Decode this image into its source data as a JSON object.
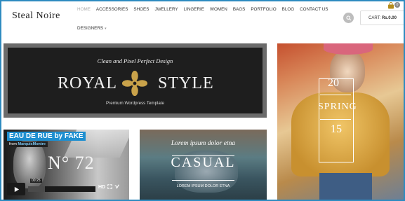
{
  "brand": {
    "logo": "Steal Noire"
  },
  "nav": {
    "items": [
      "Home",
      "Accessories",
      "Shoes",
      "Jwellery",
      "Lingerie",
      "Women",
      "Bags",
      "Portfolio",
      "Blog",
      "Contact Us"
    ],
    "row2": [
      "Designers"
    ],
    "active_index": 0
  },
  "cart": {
    "label": "CART:",
    "amount": "Rs.0.00",
    "count": "0"
  },
  "banner_royal": {
    "tagline": "Clean and Pixel Perfect Design",
    "word1": "ROYAL",
    "word2": "STYLE",
    "subtitle": "Premium Wordpress Template"
  },
  "video": {
    "title": "EAU DE RUE by FAKE",
    "from_prefix": "from",
    "author": "MarquisMontre",
    "overlay_text": "N° 72",
    "time": "00:25",
    "progress": 0.25,
    "hd": "HD"
  },
  "banner_casual": {
    "lorem_top": "Lorem ipsum dolor etna",
    "title": "CASUAL",
    "lorem_bottom": "LOREM IPSUM DOLOR ETNA"
  },
  "banner_spring": {
    "top": "20",
    "middle": "SPRING",
    "bottom": "15"
  },
  "colors": {
    "frame": "#2e8bc0",
    "video_title_bg": "#1e8fd0"
  }
}
